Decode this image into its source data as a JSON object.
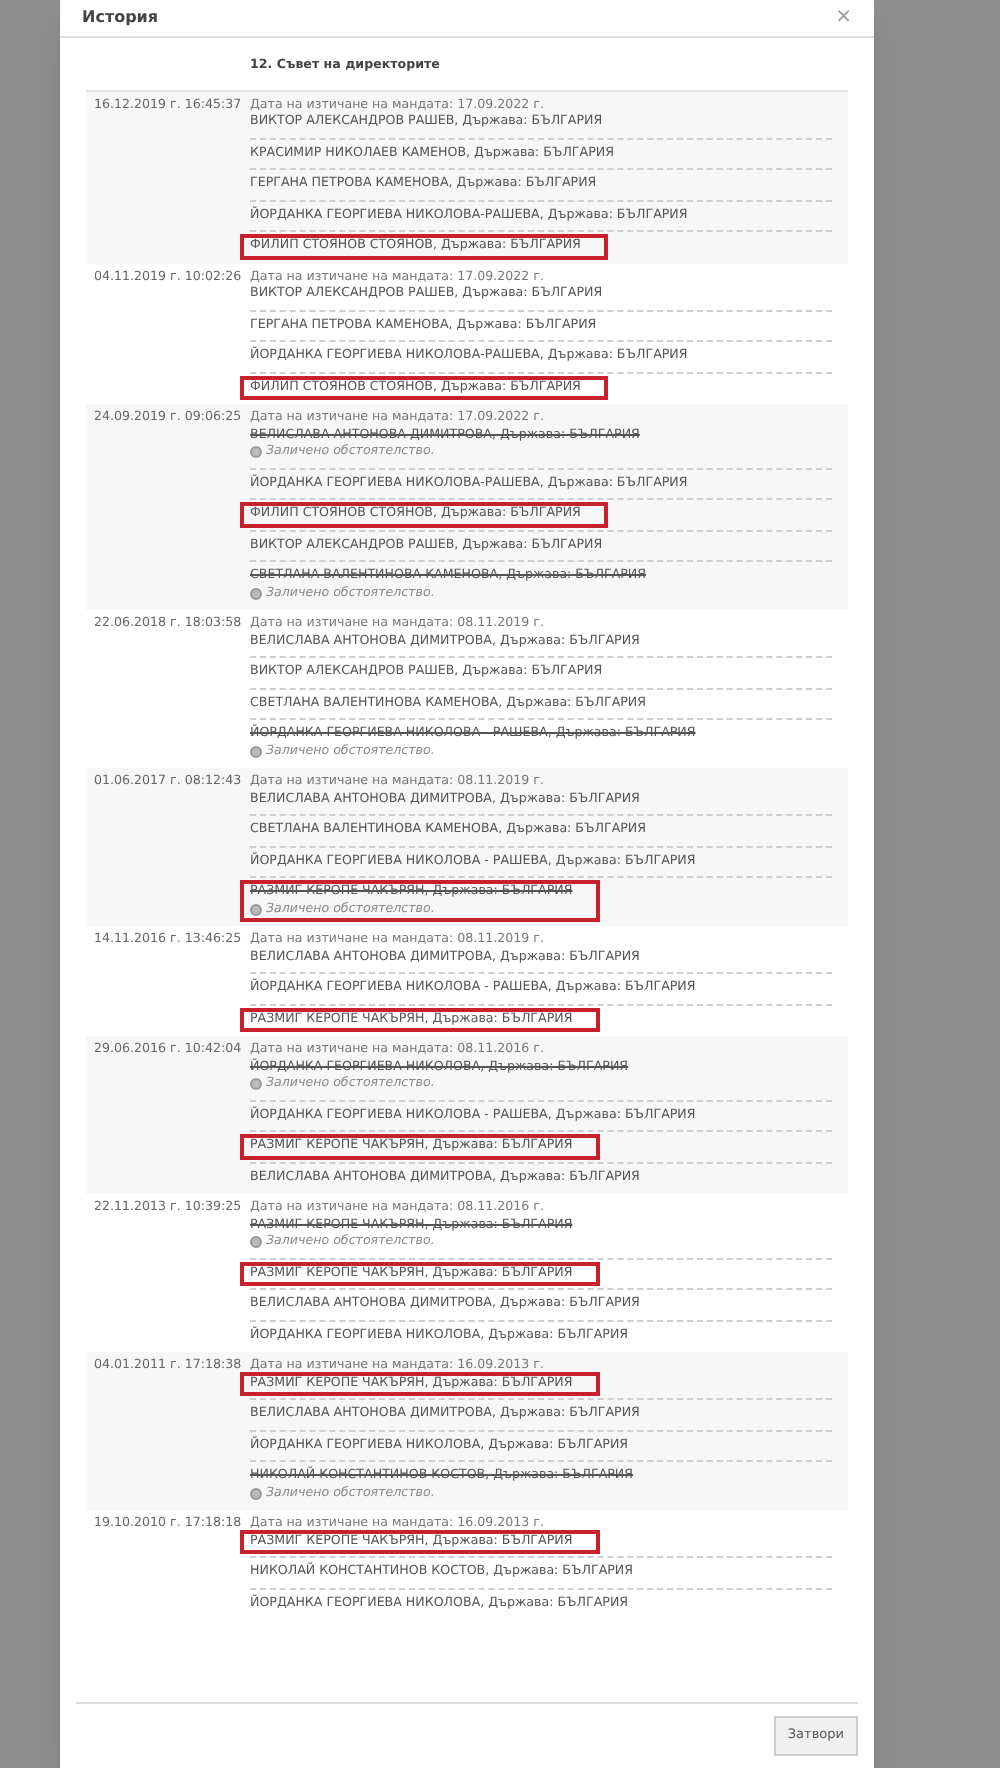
{
  "dialog": {
    "title": "История",
    "close": "×",
    "column_header": "12. Съвет на директорите",
    "close_button": "Затвори"
  },
  "records": [
    {
      "date": "16.12.2019 г. 16:45:37",
      "expiry": "Дата на изтичане на мандата: 17.09.2022 г.",
      "items": [
        {
          "text": "ВИКТОР АЛЕКСАНДРОВ РАШЕВ, Държава: БЪЛГАРИЯ",
          "struck": false,
          "highlighted": false
        },
        {
          "text": "КРАСИМИР НИКОЛАЕВ КАМЕНОВ, Държава: БЪЛГАРИЯ",
          "struck": false,
          "highlighted": false
        },
        {
          "text": "ГЕРГАНА ПЕТРОВА КАМЕНОВА, Държава: БЪЛГАРИЯ",
          "struck": false,
          "highlighted": false
        },
        {
          "text": "ЙОРДАНКА ГЕОРГИЕВА НИКОЛОВА-РАШЕВА, Държава: БЪЛГАРИЯ",
          "struck": false,
          "highlighted": false
        },
        {
          "text": "ФИЛИП СТОЯНОВ СТОЯНОВ, Държава: БЪЛГАРИЯ",
          "struck": false,
          "highlighted": true
        }
      ]
    },
    {
      "date": "04.11.2019 г. 10:02:26",
      "expiry": "Дата на изтичане на мандата: 17.09.2022 г.",
      "items": [
        {
          "text": "ВИКТОР АЛЕКСАНДРОВ РАШЕВ, Държава: БЪЛГАРИЯ",
          "struck": false,
          "highlighted": false
        },
        {
          "text": "ГЕРГАНА ПЕТРОВА КАМЕНОВА, Държава: БЪЛГАРИЯ",
          "struck": false,
          "highlighted": false
        },
        {
          "text": "ЙОРДАНКА ГЕОРГИЕВА НИКОЛОВА-РАШЕВА, Държава: БЪЛГАРИЯ",
          "struck": false,
          "highlighted": false
        },
        {
          "text": "ФИЛИП СТОЯНОВ СТОЯНОВ, Държава: БЪЛГАРИЯ",
          "struck": false,
          "highlighted": true
        }
      ]
    },
    {
      "date": "24.09.2019 г. 09:06:25",
      "expiry": "Дата на изтичане на мандата: 17.09.2022 г.",
      "items": [
        {
          "text": "ВЕЛИСЛАВА АНТОНОВА ДИМИТРОВА, Държава: БЪЛГАРИЯ",
          "struck": true,
          "note": "Заличено обстоятелство.",
          "highlighted": false
        },
        {
          "text": "ЙОРДАНКА ГЕОРГИЕВА НИКОЛОВА-РАШЕВА, Държава: БЪЛГАРИЯ",
          "struck": false,
          "highlighted": false
        },
        {
          "text": "ФИЛИП СТОЯНОВ СТОЯНОВ, Държава: БЪЛГАРИЯ",
          "struck": false,
          "highlighted": true
        },
        {
          "text": "ВИКТОР АЛЕКСАНДРОВ РАШЕВ, Държава: БЪЛГАРИЯ",
          "struck": false,
          "highlighted": false
        },
        {
          "text": "СВЕТЛАНА ВАЛЕНТИНОВА КАМЕНОВА, Държава: БЪЛГАРИЯ",
          "struck": true,
          "note": "Заличено обстоятелство.",
          "highlighted": false
        }
      ]
    },
    {
      "date": "22.06.2018 г. 18:03:58",
      "expiry": "Дата на изтичане на мандата: 08.11.2019 г.",
      "items": [
        {
          "text": "ВЕЛИСЛАВА АНТОНОВА ДИМИТРОВА, Държава: БЪЛГАРИЯ",
          "struck": false,
          "highlighted": false
        },
        {
          "text": "ВИКТОР АЛЕКСАНДРОВ РАШЕВ, Държава: БЪЛГАРИЯ",
          "struck": false,
          "highlighted": false
        },
        {
          "text": "СВЕТЛАНА ВАЛЕНТИНОВА КАМЕНОВА, Държава: БЪЛГАРИЯ",
          "struck": false,
          "highlighted": false
        },
        {
          "text": "ЙОРДАНКА ГЕОРГИЕВА НИКОЛОВА - РАШЕВА, Държава: БЪЛГАРИЯ",
          "struck": true,
          "note": "Заличено обстоятелство.",
          "highlighted": false
        }
      ]
    },
    {
      "date": "01.06.2017 г. 08:12:43",
      "expiry": "Дата на изтичане на мандата: 08.11.2019 г.",
      "items": [
        {
          "text": "ВЕЛИСЛАВА АНТОНОВА ДИМИТРОВА, Държава: БЪЛГАРИЯ",
          "struck": false,
          "highlighted": false
        },
        {
          "text": "СВЕТЛАНА ВАЛЕНТИНОВА КАМЕНОВА, Държава: БЪЛГАРИЯ",
          "struck": false,
          "highlighted": false
        },
        {
          "text": "ЙОРДАНКА ГЕОРГИЕВА НИКОЛОВА - РАШЕВА, Държава: БЪЛГАРИЯ",
          "struck": false,
          "highlighted": false
        },
        {
          "text": "РАЗМИГ КЕРОПЕ ЧАКЪРЯН, Държава: БЪЛГАРИЯ",
          "struck": true,
          "note": "Заличено обстоятелство.",
          "highlighted": true
        }
      ]
    },
    {
      "date": "14.11.2016 г. 13:46:25",
      "expiry": "Дата на изтичане на мандата: 08.11.2019 г.",
      "items": [
        {
          "text": "ВЕЛИСЛАВА АНТОНОВА ДИМИТРОВА, Държава: БЪЛГАРИЯ",
          "struck": false,
          "highlighted": false
        },
        {
          "text": "ЙОРДАНКА ГЕОРГИЕВА НИКОЛОВА - РАШЕВА, Държава: БЪЛГАРИЯ",
          "struck": false,
          "highlighted": false
        },
        {
          "text": "РАЗМИГ КЕРОПЕ ЧАКЪРЯН, Държава: БЪЛГАРИЯ",
          "struck": false,
          "highlighted": true
        }
      ]
    },
    {
      "date": "29.06.2016 г. 10:42:04",
      "expiry": "Дата на изтичане на мандата: 08.11.2016 г.",
      "items": [
        {
          "text": "ЙОРДАНКА ГЕОРГИЕВА НИКОЛОВА, Държава: БЪЛГАРИЯ",
          "struck": true,
          "note": "Заличено обстоятелство.",
          "highlighted": false
        },
        {
          "text": "ЙОРДАНКА ГЕОРГИЕВА НИКОЛОВА - РАШЕВА, Държава: БЪЛГАРИЯ",
          "struck": false,
          "highlighted": false
        },
        {
          "text": "РАЗМИГ КЕРОПЕ ЧАКЪРЯН, Държава: БЪЛГАРИЯ",
          "struck": false,
          "highlighted": true
        },
        {
          "text": "ВЕЛИСЛАВА АНТОНОВА ДИМИТРОВА, Държава: БЪЛГАРИЯ",
          "struck": false,
          "highlighted": false
        }
      ]
    },
    {
      "date": "22.11.2013 г. 10:39:25",
      "expiry": "Дата на изтичане на мандата: 08.11.2016 г.",
      "items": [
        {
          "text": "РАЗМИГ КЕРОПЕ ЧАКЪРЯН, Държава: БЪЛГАРИЯ",
          "struck": true,
          "note": "Заличено обстоятелство.",
          "highlighted": false
        },
        {
          "text": "РАЗМИГ КЕРОПЕ ЧАКЪРЯН, Държава: БЪЛГАРИЯ",
          "struck": false,
          "highlighted": true
        },
        {
          "text": "ВЕЛИСЛАВА АНТОНОВА ДИМИТРОВА, Държава: БЪЛГАРИЯ",
          "struck": false,
          "highlighted": false
        },
        {
          "text": "ЙОРДАНКА ГЕОРГИЕВА НИКОЛОВА, Държава: БЪЛГАРИЯ",
          "struck": false,
          "highlighted": false
        }
      ]
    },
    {
      "date": "04.01.2011 г. 17:18:38",
      "expiry": "Дата на изтичане на мандата: 16.09.2013 г.",
      "items": [
        {
          "text": "РАЗМИГ КЕРОПЕ ЧАКЪРЯН, Държава: БЪЛГАРИЯ",
          "struck": false,
          "highlighted": true
        },
        {
          "text": "ВЕЛИСЛАВА АНТОНОВА ДИМИТРОВА, Държава: БЪЛГАРИЯ",
          "struck": false,
          "highlighted": false
        },
        {
          "text": "ЙОРДАНКА ГЕОРГИЕВА НИКОЛОВА, Държава: БЪЛГАРИЯ",
          "struck": false,
          "highlighted": false
        },
        {
          "text": "НИКОЛАЙ КОНСТАНТИНОВ КОСТОВ, Държава: БЪЛГАРИЯ",
          "struck": true,
          "note": "Заличено обстоятелство.",
          "highlighted": false
        }
      ]
    },
    {
      "date": "19.10.2010 г. 17:18:18",
      "expiry": "Дата на изтичане на мандата: 16.09.2013 г.",
      "items": [
        {
          "text": "РАЗМИГ КЕРОПЕ ЧАКЪРЯН, Държава: БЪЛГАРИЯ",
          "struck": false,
          "highlighted": true
        },
        {
          "text": "НИКОЛАЙ КОНСТАНТИНОВ КОСТОВ, Държава: БЪЛГАРИЯ",
          "struck": false,
          "highlighted": false
        },
        {
          "text": "ЙОРДАНКА ГЕОРГИЕВА НИКОЛОВА, Държава: БЪЛГАРИЯ",
          "struck": false,
          "highlighted": false
        }
      ]
    }
  ]
}
